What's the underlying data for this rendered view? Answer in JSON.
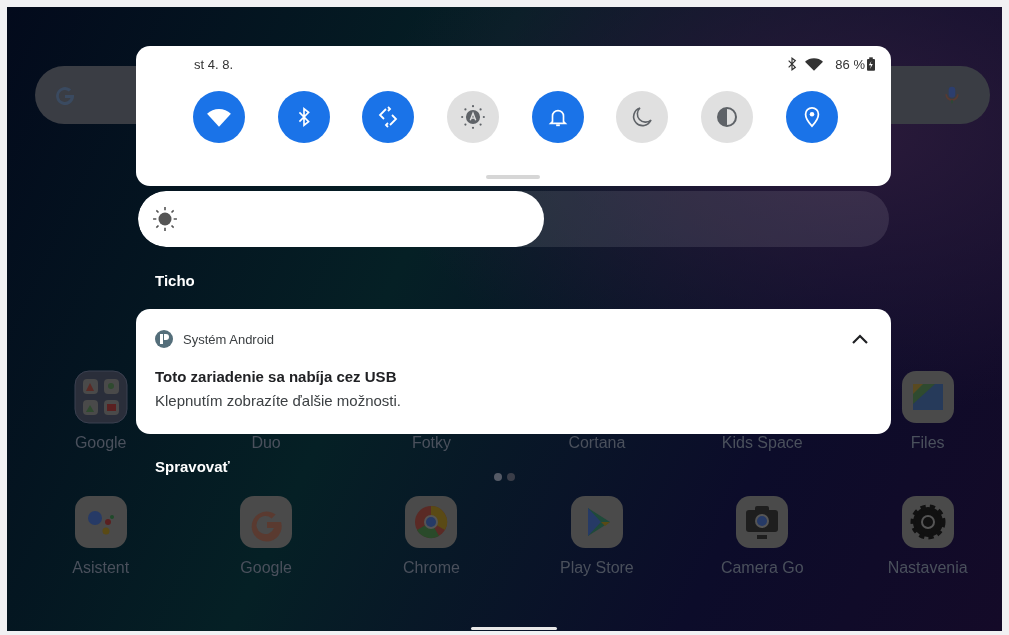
{
  "status_bar": {
    "date": "st 4. 8.",
    "battery": "86 %"
  },
  "quick_settings": {
    "tiles": [
      {
        "kind": "wifi",
        "on": true
      },
      {
        "kind": "bluetooth",
        "on": true
      },
      {
        "kind": "rotate",
        "on": true
      },
      {
        "kind": "auto-brightness",
        "on": false
      },
      {
        "kind": "sound",
        "on": true
      },
      {
        "kind": "dnd",
        "on": false
      },
      {
        "kind": "contrast",
        "on": false
      },
      {
        "kind": "location",
        "on": true
      }
    ]
  },
  "brightness": {
    "level": 0.54
  },
  "section_title": "Ticho",
  "notification": {
    "app": "Systém Android",
    "title": "Toto zariadenie sa nabíja cez USB",
    "text": "Klepnutím zobrazíte ďalšie možnosti.",
    "expanded": true
  },
  "manage_label": "Spravovať",
  "home": {
    "rows": [
      [
        {
          "kind": "folder",
          "label": "Google"
        },
        {
          "kind": "covered",
          "label": "Duo"
        },
        {
          "kind": "covered",
          "label": "Fotky"
        },
        {
          "kind": "covered",
          "label": "Cortana"
        },
        {
          "kind": "covered",
          "label": "Kids Space"
        },
        {
          "kind": "files",
          "label": "Files"
        }
      ],
      [
        {
          "kind": "assistant",
          "label": "Asistent"
        },
        {
          "kind": "google",
          "label": "Google"
        },
        {
          "kind": "chrome",
          "label": "Chrome"
        },
        {
          "kind": "play",
          "label": "Play Store"
        },
        {
          "kind": "camera",
          "label": "Camera Go"
        },
        {
          "kind": "settings",
          "label": "Nastavenia"
        }
      ]
    ],
    "pages": [
      {
        "selected": true
      },
      {
        "selected": false
      }
    ]
  }
}
